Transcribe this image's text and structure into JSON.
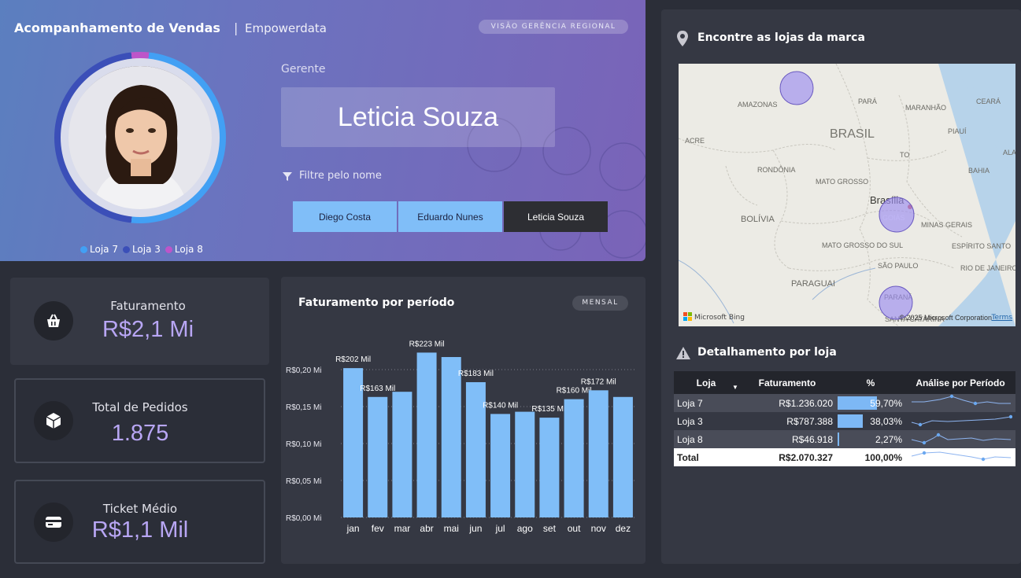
{
  "header": {
    "title": "Acompanhamento de Vendas",
    "brand": "Empowerdata",
    "view_badge": "VISÃO GERÊNCIA REGIONAL",
    "manager_label": "Gerente",
    "manager_name": "Leticia Souza",
    "filter_hint": "Filtre pelo nome",
    "name_buttons": [
      {
        "label": "Diego Costa",
        "selected": false
      },
      {
        "label": "Eduardo Nunes",
        "selected": false
      },
      {
        "label": "Leticia Souza",
        "selected": true
      }
    ],
    "store_legend": [
      {
        "label": "Loja 7",
        "color": "#42a0f4"
      },
      {
        "label": "Loja 3",
        "color": "#3b4fb8"
      },
      {
        "label": "Loja 8",
        "color": "#bd55c9"
      }
    ]
  },
  "kpis": {
    "faturamento": {
      "label": "Faturamento",
      "value": "R$2,1 Mi",
      "icon": "basket-icon"
    },
    "pedidos": {
      "label": "Total de Pedidos",
      "value": "1.875",
      "icon": "box-icon"
    },
    "ticket": {
      "label": "Ticket Médio",
      "value": "R$1,1 Mil",
      "icon": "card-icon"
    }
  },
  "chart_data": {
    "type": "bar",
    "title": "Faturamento por período",
    "badge": "MENSAL",
    "categories": [
      "jan",
      "fev",
      "mar",
      "abr",
      "mai",
      "jun",
      "jul",
      "ago",
      "set",
      "out",
      "nov",
      "dez"
    ],
    "values": [
      0.202,
      0.163,
      0.17,
      0.223,
      0.217,
      0.183,
      0.14,
      0.143,
      0.135,
      0.16,
      0.172,
      0.163
    ],
    "data_labels": [
      "R$202 Mil",
      "R$163 Mil",
      "",
      "R$223 Mil",
      "",
      "R$183 Mil",
      "R$140 Mil",
      "",
      "R$135 Mil",
      "R$160 Mil",
      "R$172 Mil",
      ""
    ],
    "y_ticks": [
      "R$0,00 Mi",
      "R$0,05 Mi",
      "R$0,10 Mi",
      "R$0,15 Mi",
      "R$0,20 Mi"
    ],
    "ylim": [
      0,
      0.25
    ],
    "bar_color": "#80bef8",
    "grid": true
  },
  "map": {
    "title": "Encontre as lojas da marca",
    "attribution": "© 2025 Microsoft Corporation",
    "terms": "Terms",
    "bing": "Microsoft Bing",
    "labels": [
      "AMAZONAS",
      "PARÁ",
      "MARANHÃO",
      "CEARÁ",
      "BRASIL",
      "PIAUÍ",
      "ACRE",
      "TO",
      "RONDÔNIA",
      "BAHIA",
      "MATO GROSSO",
      "Brasília",
      "GOIÁS",
      "BOLÍVIA",
      "MINAS GERAIS",
      "MATO GROSSO DO SUL",
      "ESPÍRITO SANTO",
      "PARAGUAI",
      "SÃO PAULO",
      "RIO DE JANEIRO",
      "PARANÁ",
      "SANTA CATARINA",
      "ALAGOAS"
    ]
  },
  "detail": {
    "title": "Detalhamento por loja",
    "columns": [
      "Loja",
      "Faturamento",
      "%",
      "Análise por Período"
    ],
    "rows": [
      {
        "loja": "Loja 7",
        "fat": "R$1.236.020",
        "pct": "59,70%",
        "pct_value": 59.7
      },
      {
        "loja": "Loja 3",
        "fat": "R$787.388",
        "pct": "38,03%",
        "pct_value": 38.03
      },
      {
        "loja": "Loja 8",
        "fat": "R$46.918",
        "pct": "2,27%",
        "pct_value": 2.27
      }
    ],
    "total": {
      "loja": "Total",
      "fat": "R$2.070.327",
      "pct": "100,00%"
    }
  }
}
